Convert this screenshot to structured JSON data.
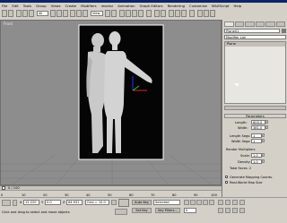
{
  "menu": [
    "File",
    "Edit",
    "Tools",
    "Group",
    "Views",
    "Create",
    "Modifiers",
    "reactor",
    "Animation",
    "Graph Editors",
    "Rendering",
    "Customize",
    "MAXScript",
    "Help"
  ],
  "toolbar": {
    "selection_filter": "All",
    "view_dropdown": "View"
  },
  "viewport": {
    "label": "Front"
  },
  "command_panel": {
    "object_name": "Plane01",
    "modifier_list": "Modifier List",
    "stack_item": "Plane",
    "parameters_title": "Parameters",
    "length_label": "Length:",
    "length_value": "600.0",
    "width_label": "Width:",
    "width_value": "381.0",
    "length_segs_label": "Length Segs:",
    "length_segs_value": "1",
    "width_segs_label": "Width Segs:",
    "width_segs_value": "1",
    "render_multipliers_label": "Render Multipliers",
    "scale_label": "Scale:",
    "scale_value": "1.0",
    "density_label": "Density:",
    "density_value": "1.0",
    "total_faces_label": "Total Faces: 2",
    "gen_mapping_label": "Generate Mapping Coords.",
    "real_world_label": "Real-World Map Size"
  },
  "timeline": {
    "frame_counter": "0 / 100",
    "ticks": [
      "0",
      "10",
      "20",
      "30",
      "40",
      "50",
      "60",
      "70",
      "80",
      "90",
      "100"
    ]
  },
  "statusbar": {
    "x_label": "X",
    "x_value": "15.220",
    "y_label": "Y",
    "y_value": "0.0",
    "z_label": "Z",
    "z_value": "64.931",
    "grid_label": "Grid = 10.0",
    "autokey_label": "Auto Key",
    "selected_label": "Selected",
    "setkey_label": "Set Key",
    "keyfilters_label": "Key Filters...",
    "prompt": "Click and drag to select and move objects",
    "frame_value": "0"
  },
  "colors": {
    "title_bar": "#0b246a",
    "ui_gray": "#d4d0c8",
    "viewport_bg": "#8d8d8d",
    "accent_red": "#c0201c"
  }
}
